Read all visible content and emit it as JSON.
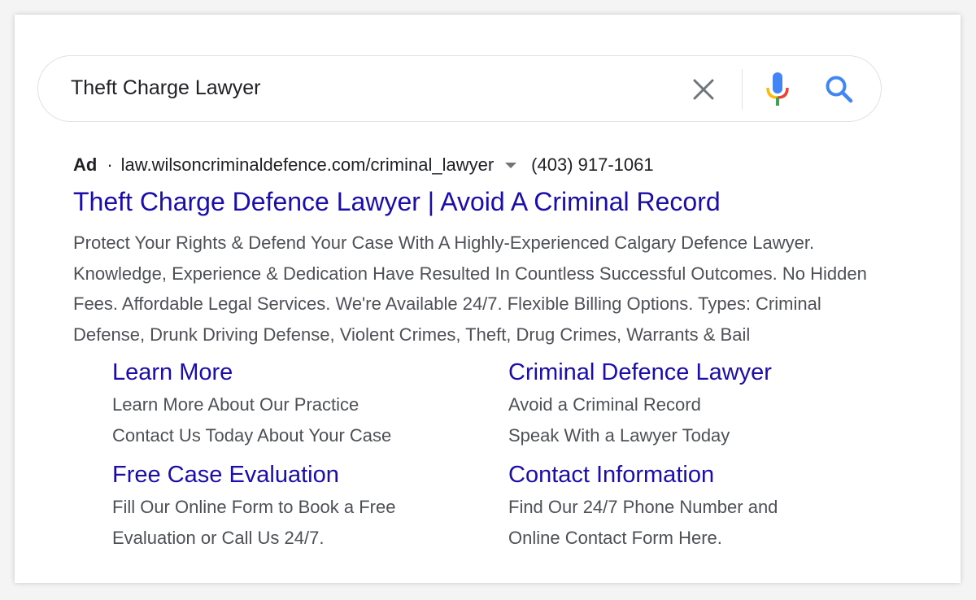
{
  "search": {
    "query": "Theft Charge Lawyer",
    "icons": {
      "clear": "close-icon",
      "voice": "microphone-icon",
      "submit": "search-icon"
    },
    "colors": {
      "mic_blue": "#4285f4",
      "mic_red": "#ea4335",
      "mic_yellow": "#fbbc05",
      "mic_green": "#34a853",
      "search_blue": "#4285f4",
      "clear_gray": "#70757a"
    }
  },
  "ad": {
    "label": "Ad",
    "separator": "·",
    "url": "law.wilsoncriminaldefence.com/criminal_lawyer",
    "phone": "(403) 917-1061",
    "title": "Theft Charge Defence Lawyer | Avoid A Criminal Record",
    "description": "Protect Your Rights & Defend Your Case With A Highly-Experienced Calgary Defence Lawyer. Knowledge, Experience & Dedication Have Resulted In Countless Successful Outcomes. No Hidden Fees. Affordable Legal Services. We're Available 24/7. Flexible Billing Options. Types: Criminal Defense, Drunk Driving Defense, Violent Crimes, Theft, Drug Crimes, Warrants & Bail",
    "colors": {
      "link": "#1a0dab",
      "text": "#4d5156"
    }
  },
  "sitelinks": [
    {
      "title": "Learn More",
      "lines": [
        "Learn More About Our Practice",
        "Contact Us Today About Your Case"
      ]
    },
    {
      "title": "Criminal Defence Lawyer",
      "lines": [
        "Avoid a Criminal Record",
        "Speak With a Lawyer Today"
      ]
    },
    {
      "title": "Free Case Evaluation",
      "lines": [
        "Fill Our Online Form to Book a Free",
        "Evaluation or Call Us 24/7."
      ]
    },
    {
      "title": "Contact Information",
      "lines": [
        "Find Our 24/7 Phone Number and",
        "Online Contact Form Here."
      ]
    }
  ]
}
